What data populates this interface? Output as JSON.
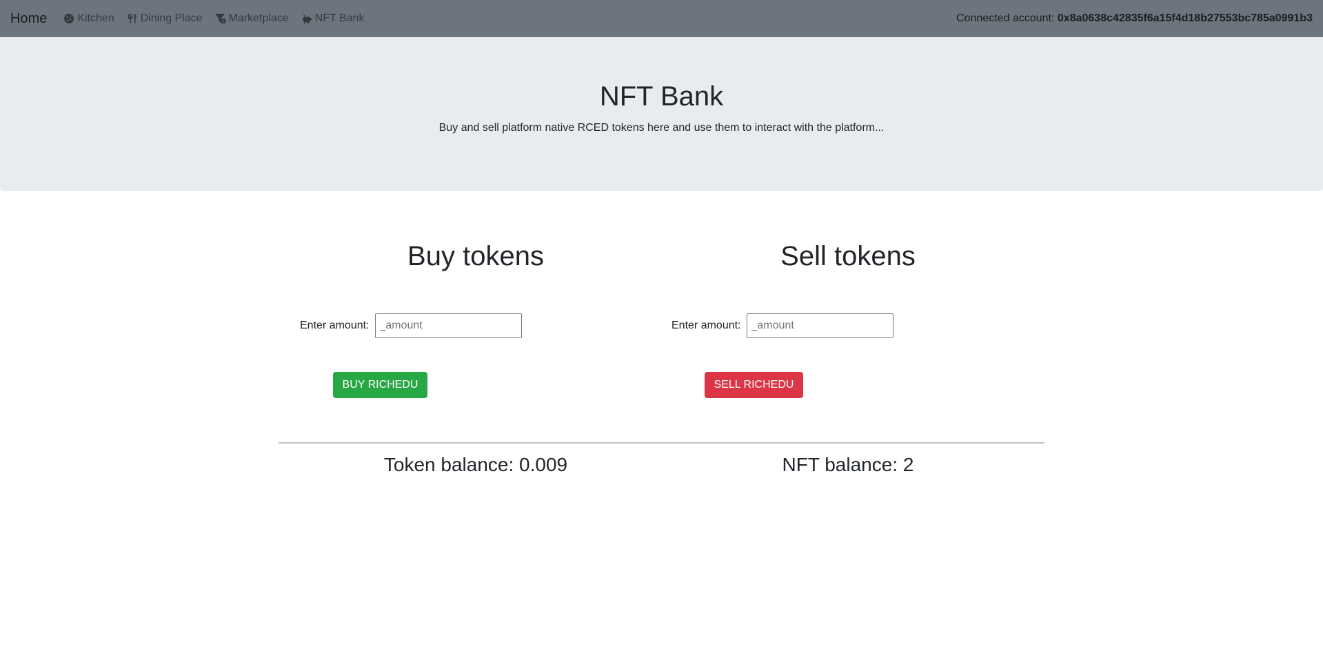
{
  "nav": {
    "brand": "Home",
    "items": [
      {
        "label": "Kitchen",
        "icon": "cookie-icon"
      },
      {
        "label": "Dining Place",
        "icon": "utensils-icon"
      },
      {
        "label": "Marketplace",
        "icon": "funnel-dollar-icon"
      },
      {
        "label": "NFT Bank",
        "icon": "piggy-bank-icon"
      }
    ],
    "account_label": "Connected account:",
    "account_address": "0x8a0638c42835f6a15f4d18b27553bc785a0991b3"
  },
  "hero": {
    "title": "NFT Bank",
    "subtitle": "Buy and sell platform native RCED tokens here and use them to interact with the platform..."
  },
  "buy": {
    "heading": "Buy tokens",
    "amount_label": "Enter amount:",
    "placeholder": "_amount",
    "button_label": "BUY RICHEDU"
  },
  "sell": {
    "heading": "Sell tokens",
    "amount_label": "Enter amount:",
    "placeholder": "_amount",
    "button_label": "SELL RICHEDU"
  },
  "balances": {
    "token": "Token balance: 0.009",
    "nft": "NFT balance: 2"
  },
  "colors": {
    "navbar": "#6c757d",
    "hero": "#e9ecef",
    "buy": "#28a745",
    "sell": "#dc3545"
  }
}
